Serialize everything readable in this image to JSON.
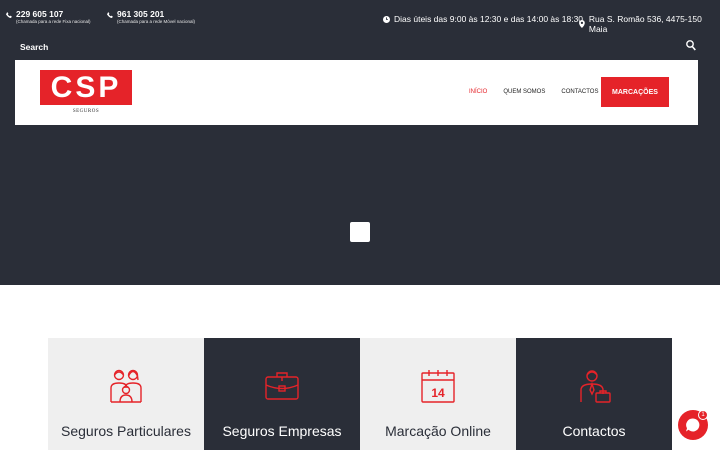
{
  "topbar": {
    "phones": [
      {
        "number": "229 605 107",
        "note": "(Chamada para a rede Fixa nacional)"
      },
      {
        "number": "961 305 201",
        "note": "(Chamada para a rede Móvel nacional)"
      }
    ],
    "hours": "Dias úteis das 9:00 às 12:30 e das 14:00 às 18:30",
    "address": "Rua S. Romão 536, 4475-150 Maia"
  },
  "search": {
    "label": "Search"
  },
  "logo": {
    "letters": "CSP",
    "subtitle": "SEGUROS"
  },
  "nav": {
    "links": [
      "INÍCIO",
      "QUEM SOMOS",
      "CONTACTOS"
    ],
    "cta": "MARCAÇÕES"
  },
  "cards": [
    {
      "title": "Seguros Particulares",
      "icon": "family-icon"
    },
    {
      "title": "Seguros Empresas",
      "icon": "briefcase-icon"
    },
    {
      "title": "Marcação Online",
      "icon": "calendar-icon"
    },
    {
      "title": "Contactos",
      "icon": "businessman-icon"
    }
  ],
  "calendar_day": "14",
  "chat": {
    "badge": "1"
  },
  "colors": {
    "accent": "#e52329",
    "dark": "#2a2e38",
    "light": "#efefef"
  }
}
